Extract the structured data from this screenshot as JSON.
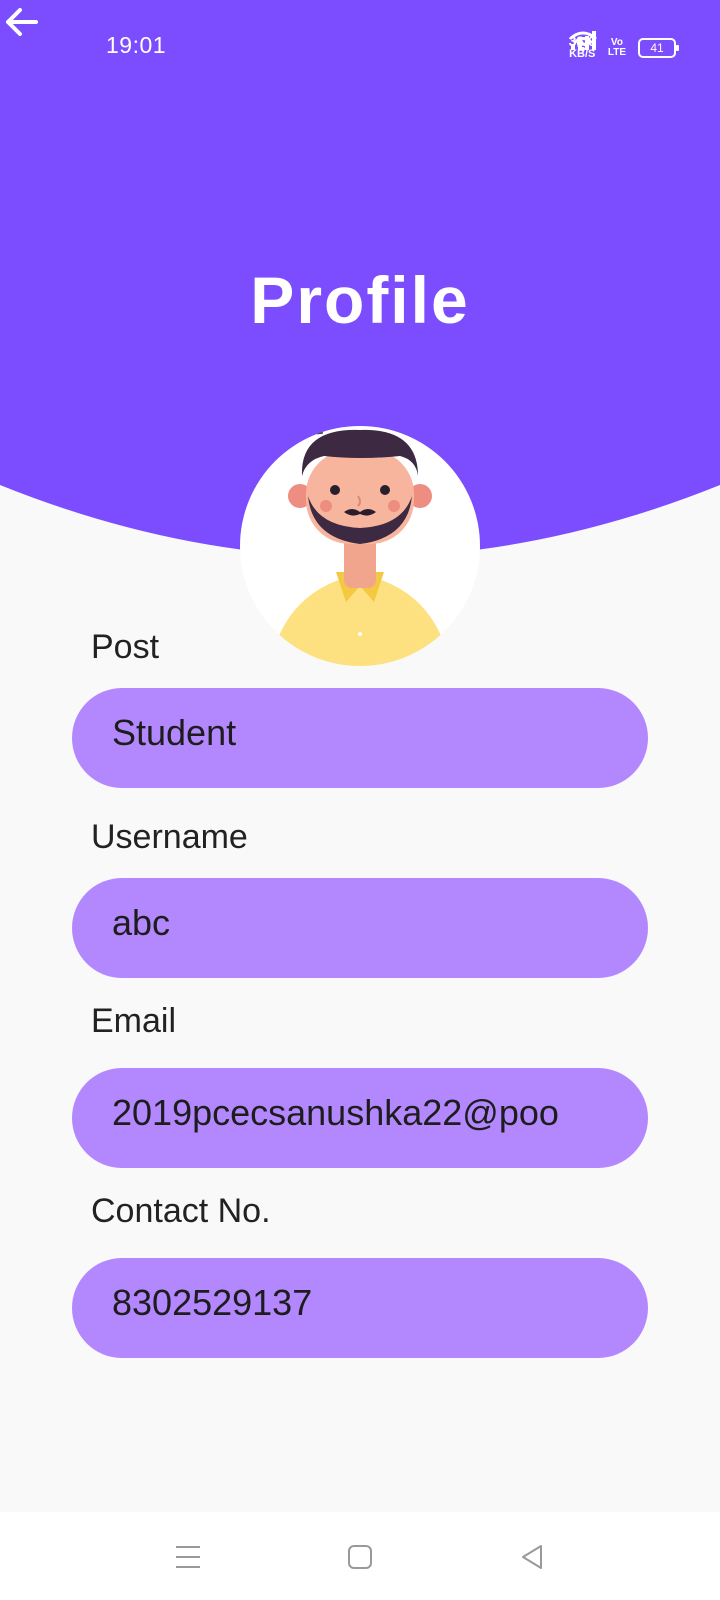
{
  "status_bar": {
    "time": "19:01",
    "net_speed": "38.0",
    "net_unit": "KB/S",
    "volte_top": "Vo",
    "volte_bottom": "LTE",
    "battery": "41"
  },
  "header": {
    "title": "Profile",
    "background_color": "#7c4dff"
  },
  "avatar": {
    "alt": "profile avatar illustration"
  },
  "fields": [
    {
      "label": "Post",
      "value": "Student"
    },
    {
      "label": "Username",
      "value": "abc"
    },
    {
      "label": "Email",
      "value": "2019pcecsanushka22@poo"
    },
    {
      "label": "Contact No.",
      "value": "8302529137"
    }
  ],
  "field_color": "#b388ff",
  "nav_bar": {
    "icons": [
      "menu-icon",
      "home-icon",
      "back-triangle-icon"
    ]
  }
}
